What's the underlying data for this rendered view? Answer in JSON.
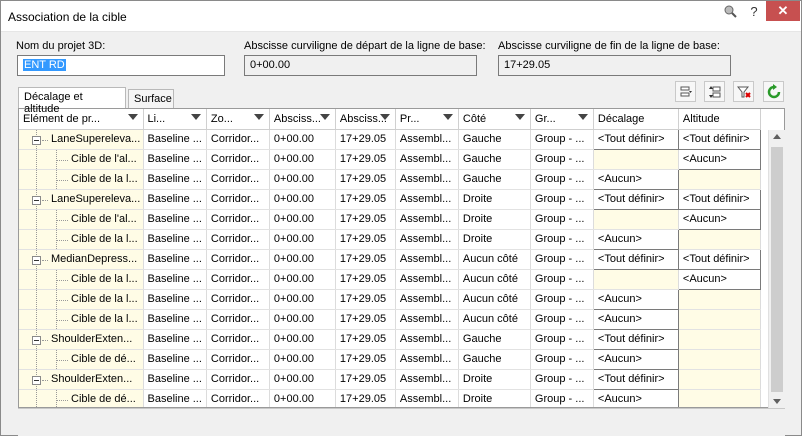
{
  "window": {
    "title": "Association de la cible",
    "pin_icon": "pin-icon",
    "help_label": "?",
    "close_label": "✕"
  },
  "fields": {
    "project_label": "Nom du projet 3D:",
    "project_value": "ENT RD",
    "start_label": "Abscisse curviligne de départ de la ligne de base:",
    "start_value": "0+00.00",
    "end_label": "Abscisse curviligne de fin de la ligne de base:",
    "end_value": "17+29.05"
  },
  "tabs": [
    {
      "label": "Décalage et altitude",
      "active": true
    },
    {
      "label": "Surface",
      "active": false
    }
  ],
  "toolbar": {
    "icons": [
      "filter-options-icon",
      "sort-options-icon",
      "clear-filter-icon",
      "refresh-icon"
    ]
  },
  "grid": {
    "columns": [
      "Elément de pr...",
      "Li...",
      "Zo...",
      "Absciss...",
      "Absciss...",
      "Pr...",
      "Côté",
      "Gr...",
      "Décalage",
      "Altitude"
    ],
    "rows": [
      {
        "level": 0,
        "c0": "LaneSupereleva...",
        "c1": "Baseline ...",
        "c2": "Corridor...",
        "c3": "0+00.00",
        "c4": "17+29.05",
        "c5": "Assembl...",
        "c6": "Gauche",
        "c7": "Group - ...",
        "c8": "<Tout définir>",
        "c9": "<Tout définir>"
      },
      {
        "level": 1,
        "c0": "Cible de l'al...",
        "c1": "Baseline ...",
        "c2": "Corridor...",
        "c3": "0+00.00",
        "c4": "17+29.05",
        "c5": "Assembl...",
        "c6": "Gauche",
        "c7": "Group - ...",
        "c8": "",
        "c9": "<Aucun>"
      },
      {
        "level": 1,
        "c0": "Cible de la l...",
        "c1": "Baseline ...",
        "c2": "Corridor...",
        "c3": "0+00.00",
        "c4": "17+29.05",
        "c5": "Assembl...",
        "c6": "Gauche",
        "c7": "Group - ...",
        "c8": "<Aucun>",
        "c9": ""
      },
      {
        "level": 0,
        "c0": "LaneSupereleva...",
        "c1": "Baseline ...",
        "c2": "Corridor...",
        "c3": "0+00.00",
        "c4": "17+29.05",
        "c5": "Assembl...",
        "c6": "Droite",
        "c7": "Group - ...",
        "c8": "<Tout définir>",
        "c9": "<Tout définir>"
      },
      {
        "level": 1,
        "c0": "Cible de l'al...",
        "c1": "Baseline ...",
        "c2": "Corridor...",
        "c3": "0+00.00",
        "c4": "17+29.05",
        "c5": "Assembl...",
        "c6": "Droite",
        "c7": "Group - ...",
        "c8": "",
        "c9": "<Aucun>"
      },
      {
        "level": 1,
        "c0": "Cible de la l...",
        "c1": "Baseline ...",
        "c2": "Corridor...",
        "c3": "0+00.00",
        "c4": "17+29.05",
        "c5": "Assembl...",
        "c6": "Droite",
        "c7": "Group - ...",
        "c8": "<Aucun>",
        "c9": ""
      },
      {
        "level": 0,
        "c0": "MedianDepress...",
        "c1": "Baseline ...",
        "c2": "Corridor...",
        "c3": "0+00.00",
        "c4": "17+29.05",
        "c5": "Assembl...",
        "c6": "Aucun côté",
        "c7": "Group - ...",
        "c8": "<Tout définir>",
        "c9": "<Tout définir>"
      },
      {
        "level": 1,
        "c0": "Cible de la l...",
        "c1": "Baseline ...",
        "c2": "Corridor...",
        "c3": "0+00.00",
        "c4": "17+29.05",
        "c5": "Assembl...",
        "c6": "Aucun côté",
        "c7": "Group - ...",
        "c8": "",
        "c9": "<Aucun>"
      },
      {
        "level": 1,
        "c0": "Cible de la l...",
        "c1": "Baseline ...",
        "c2": "Corridor...",
        "c3": "0+00.00",
        "c4": "17+29.05",
        "c5": "Assembl...",
        "c6": "Aucun côté",
        "c7": "Group - ...",
        "c8": "<Aucun>",
        "c9": ""
      },
      {
        "level": 1,
        "c0": "Cible de la l...",
        "c1": "Baseline ...",
        "c2": "Corridor...",
        "c3": "0+00.00",
        "c4": "17+29.05",
        "c5": "Assembl...",
        "c6": "Aucun côté",
        "c7": "Group - ...",
        "c8": "<Aucun>",
        "c9": ""
      },
      {
        "level": 0,
        "c0": "ShoulderExten...",
        "c1": "Baseline ...",
        "c2": "Corridor...",
        "c3": "0+00.00",
        "c4": "17+29.05",
        "c5": "Assembl...",
        "c6": "Gauche",
        "c7": "Group - ...",
        "c8": "<Tout définir>",
        "c9": ""
      },
      {
        "level": 1,
        "c0": "Cible de dé...",
        "c1": "Baseline ...",
        "c2": "Corridor...",
        "c3": "0+00.00",
        "c4": "17+29.05",
        "c5": "Assembl...",
        "c6": "Gauche",
        "c7": "Group - ...",
        "c8": "<Aucun>",
        "c9": ""
      },
      {
        "level": 0,
        "c0": "ShoulderExten...",
        "c1": "Baseline ...",
        "c2": "Corridor...",
        "c3": "0+00.00",
        "c4": "17+29.05",
        "c5": "Assembl...",
        "c6": "Droite",
        "c7": "Group - ...",
        "c8": "<Tout définir>",
        "c9": ""
      },
      {
        "level": 1,
        "c0": "Cible de dé...",
        "c1": "Baseline ...",
        "c2": "Corridor...",
        "c3": "0+00.00",
        "c4": "17+29.05",
        "c5": "Assembl...",
        "c6": "Droite",
        "c7": "Group - ...",
        "c8": "<Aucun>",
        "c9": ""
      }
    ]
  }
}
